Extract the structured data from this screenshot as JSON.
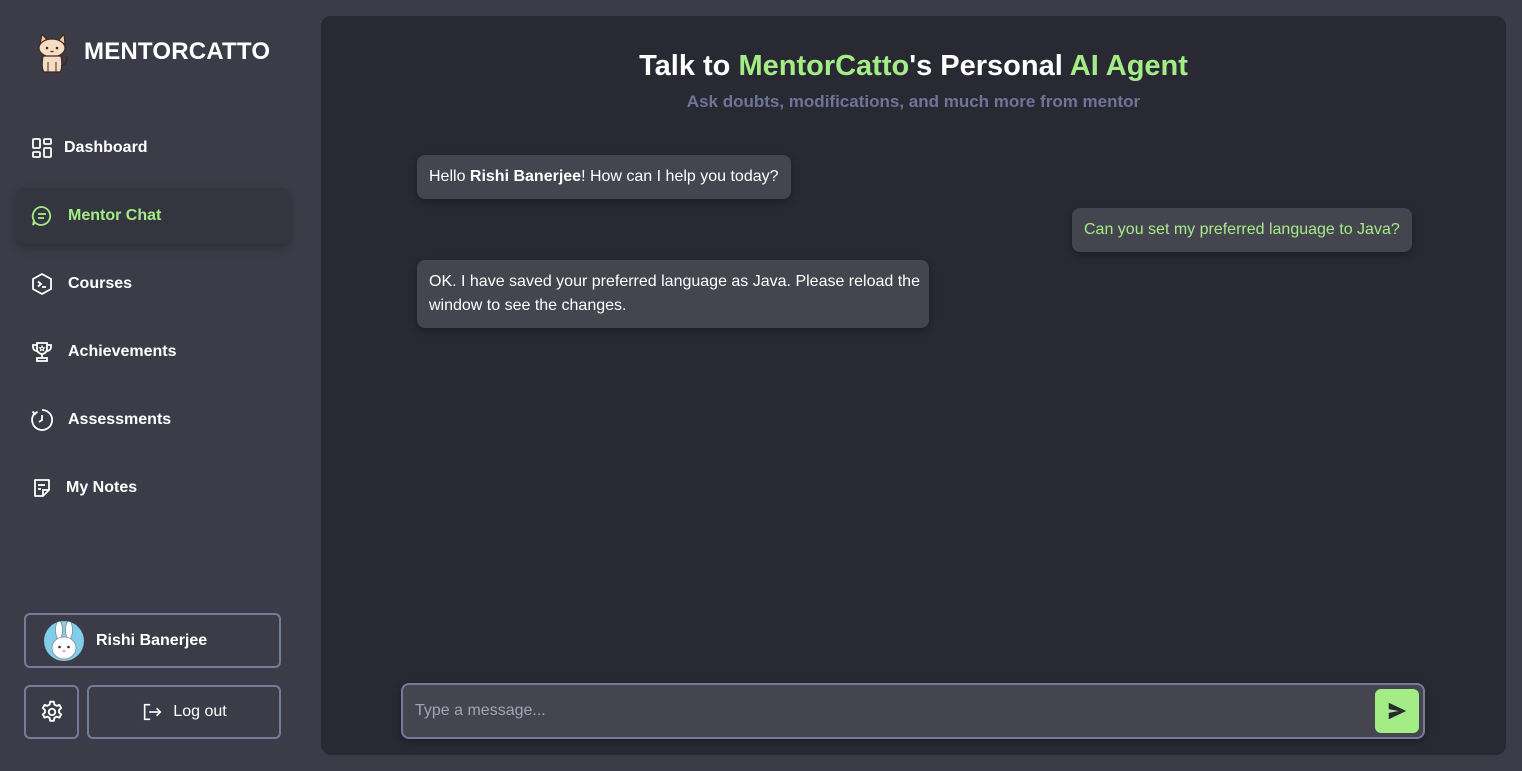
{
  "brand": {
    "name": "MENTORCATTO",
    "logo_icon": "cat-logo-icon"
  },
  "sidebar": {
    "items": [
      {
        "label": "Dashboard",
        "icon": "dashboard-grid-icon",
        "active": false
      },
      {
        "label": "Mentor Chat",
        "icon": "chat-bubble-icon",
        "active": true
      },
      {
        "label": "Courses",
        "icon": "terminal-hexagon-icon",
        "active": false
      },
      {
        "label": "Achievements",
        "icon": "trophy-icon",
        "active": false
      },
      {
        "label": "Assessments",
        "icon": "timer-icon",
        "active": false
      },
      {
        "label": "My Notes",
        "icon": "note-icon",
        "active": false
      }
    ],
    "profile": {
      "name": "Rishi Banerjee",
      "avatar_icon": "bunny-avatar"
    },
    "settings_icon": "gear-icon",
    "logout_label": "Log out"
  },
  "main": {
    "title": {
      "part1": "Talk to ",
      "accent1": "MentorCatto",
      "part2": "'s Personal ",
      "accent2": "AI Agent"
    },
    "subtitle": "Ask doubts, modifications, and much more from mentor",
    "messages": [
      {
        "role": "bot",
        "prefix": "Hello ",
        "bold": "Rishi Banerjee",
        "suffix": "! How can I help you today?"
      },
      {
        "role": "user",
        "text": "Can you set my preferred language to Java?"
      },
      {
        "role": "bot",
        "line1": "OK. I have saved your preferred language as Java. Please reload the",
        "line2": "window to see the changes."
      }
    ],
    "composer": {
      "placeholder": "Type a message...",
      "value": "",
      "send_icon": "send-icon"
    }
  },
  "colors": {
    "accent": "#a4ec86",
    "sidebar_bg": "#3b3c48",
    "panel_bg": "#282933",
    "bubble_bg": "#44454f",
    "border": "#767b99",
    "subtitle": "#6f7596"
  }
}
